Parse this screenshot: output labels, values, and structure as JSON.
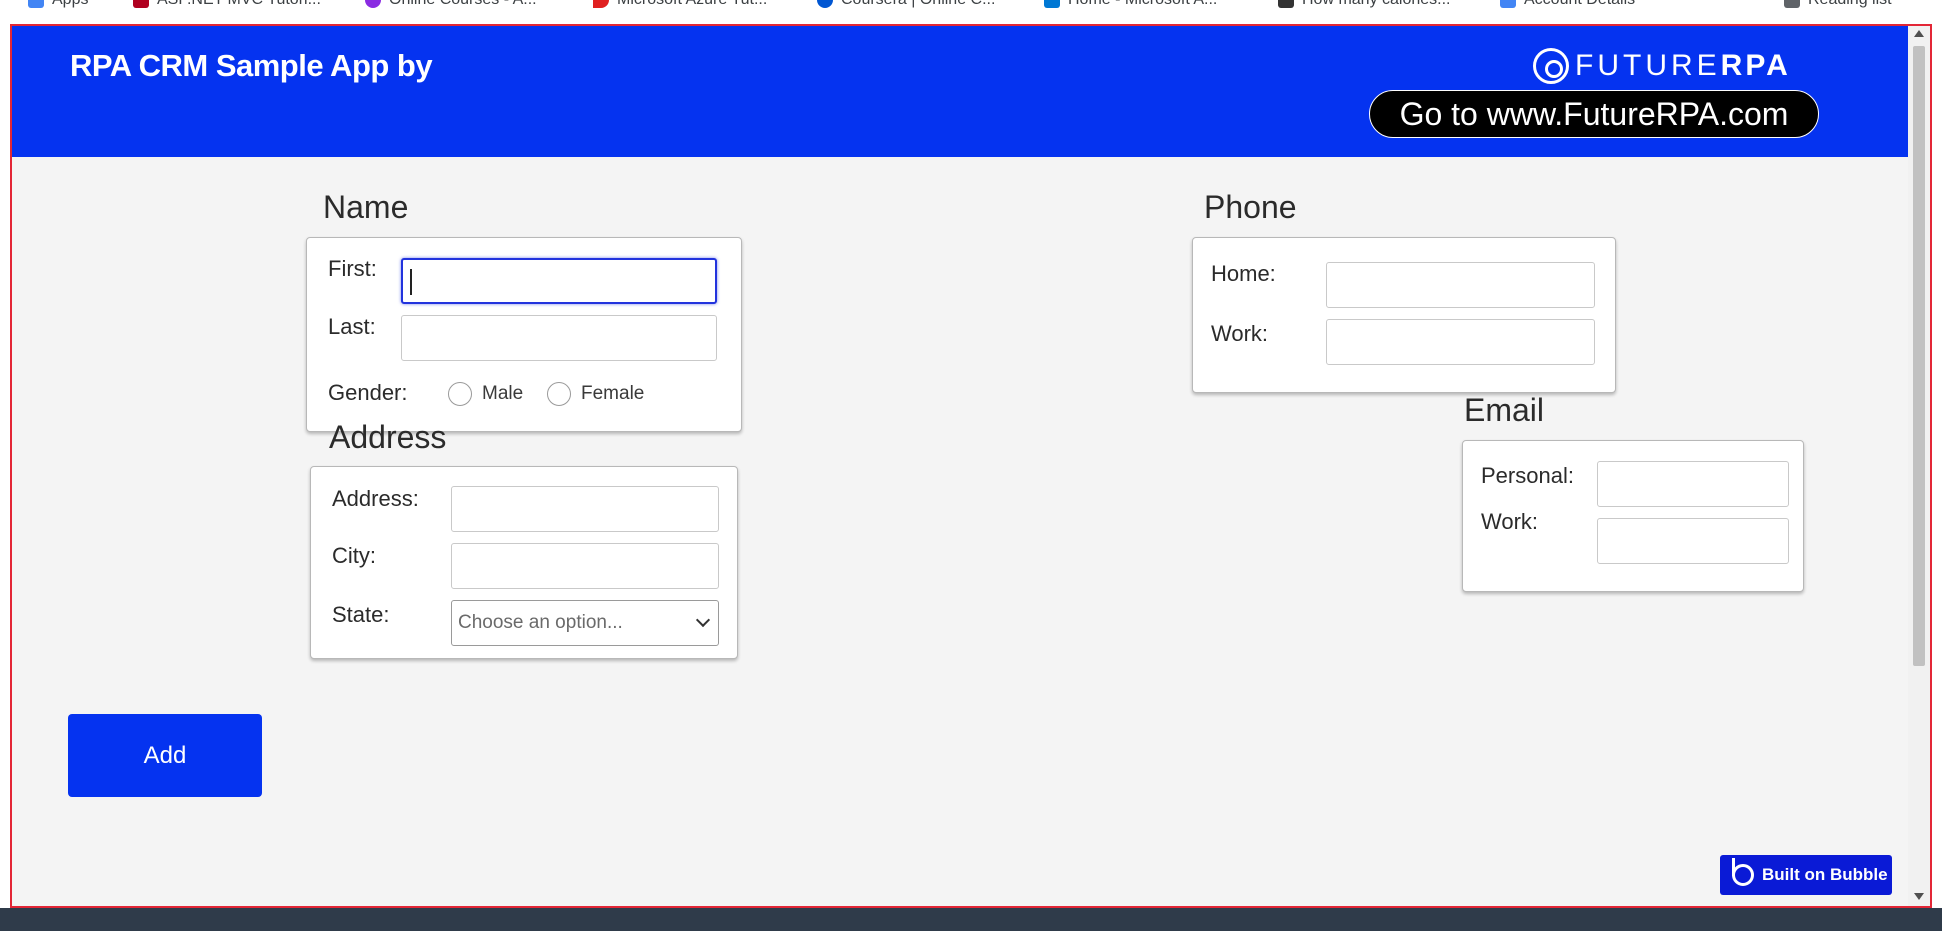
{
  "bookmarks": [
    {
      "label": "Apps",
      "color": "#4285f4"
    },
    {
      "label": "ASP.NET MVC Tutori...",
      "color": "#b00020"
    },
    {
      "label": "Online Courses - A...",
      "color": "#8a2be2"
    },
    {
      "label": "Microsoft Azure Tut...",
      "color": "#e02020"
    },
    {
      "label": "Coursera | Online C...",
      "color": "#0056d2"
    },
    {
      "label": "Home - Microsoft A...",
      "color": "#0078d4"
    },
    {
      "label": "How many calories...",
      "color": "#333333"
    },
    {
      "label": "Account Details",
      "color": "#4285f4"
    },
    {
      "label": "Reading list",
      "color": "#5f6368"
    }
  ],
  "header": {
    "title": "RPA CRM Sample App by",
    "logo_light": "FUTURE",
    "logo_bold": "RPA",
    "goto_label": "Go to www.FutureRPA.com"
  },
  "name_section": {
    "title": "Name",
    "first_label": "First:",
    "first_value": "",
    "last_label": "Last:",
    "last_value": "",
    "gender_label": "Gender:",
    "gender_options": [
      "Male",
      "Female"
    ]
  },
  "address_section": {
    "title": "Address",
    "address_label": "Address:",
    "city_label": "City:",
    "state_label": "State:",
    "state_placeholder": "Choose an option..."
  },
  "phone_section": {
    "title": "Phone",
    "home_label": "Home:",
    "work_label": "Work:"
  },
  "email_section": {
    "title": "Email",
    "personal_label": "Personal:",
    "work_label": "Work:"
  },
  "actions": {
    "add_label": "Add"
  },
  "badge": {
    "label": "Built on Bubble"
  },
  "colors": {
    "header_bg": "#0533f0",
    "page_bg": "#f4f4f4",
    "frame_border": "#e32636",
    "focus_border": "#2233dd"
  }
}
